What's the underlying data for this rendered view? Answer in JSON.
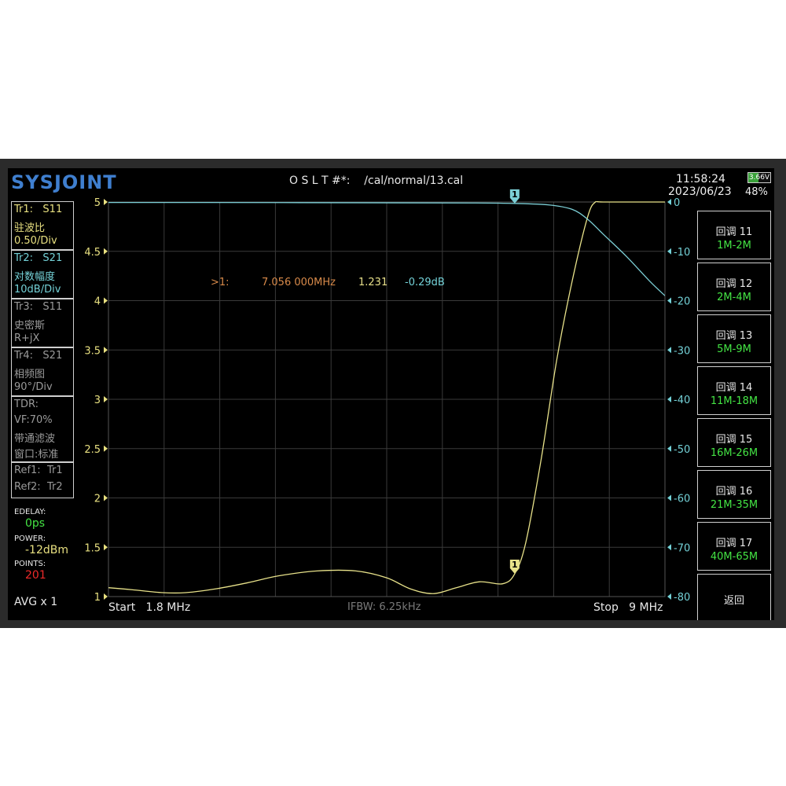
{
  "header": {
    "logo": "SYSJOINT",
    "cal_file": "O S L T #*:    /cal/normal/13.cal",
    "time": "11:58:24",
    "date": "2023/06/23",
    "battery_voltage": "3.66V",
    "battery_percent": "48%",
    "battery_fill_fraction": 0.48
  },
  "traces": [
    {
      "title": "Tr1:   S11",
      "format": "驻波比",
      "scale": "0.50/Div"
    },
    {
      "title": "Tr2:   S21",
      "format": "对数幅度",
      "scale": "10dB/Div"
    },
    {
      "title": "Tr3:   S11",
      "format": "史密斯",
      "scale": "R+jX"
    },
    {
      "title": "Tr4:   S21",
      "format": "相频图",
      "scale": "90°/Div"
    }
  ],
  "tdr": {
    "line1": "TDR:",
    "line2": "VF:70%",
    "line3": "带通滤波",
    "line4": "窗口:标准"
  },
  "refs": {
    "ref1": "Ref1:  Tr1",
    "ref2": "Ref2:  Tr2"
  },
  "params": {
    "edelay_label": "EDELAY:",
    "edelay_value": "0ps",
    "power_label": "POWER:",
    "power_value": "-12dBm",
    "points_label": "POINTS:",
    "points_value": "201",
    "avg": "AVG x 1"
  },
  "marker_readout": {
    "label": ">1:",
    "freq": "7.056 000MHz",
    "swr": "1.231",
    "db": "-0.29dB"
  },
  "sweep": {
    "start": "Start   1.8 MHz",
    "ifbw": "IFBW: 6.25kHz",
    "stop": "Stop   9 MHz"
  },
  "softkeys": [
    {
      "line1": "回调 11",
      "line2": "1M-2M"
    },
    {
      "line1": "回调 12",
      "line2": "2M-4M"
    },
    {
      "line1": "回调 13",
      "line2": "5M-9M"
    },
    {
      "line1": "回调 14",
      "line2": "11M-18M"
    },
    {
      "line1": "回调 15",
      "line2": "16M-26M"
    },
    {
      "line1": "回调 16",
      "line2": "21M-35M"
    },
    {
      "line1": "回调 17",
      "line2": "40M-65M"
    },
    {
      "line1": "返回",
      "line2": ""
    }
  ],
  "chart_data": {
    "type": "line",
    "x_range_mhz": [
      1.8,
      9
    ],
    "left_axis": {
      "ticks": [
        "5",
        "4.5",
        "4",
        "3.5",
        "3",
        "2.5",
        "2",
        "1.5",
        "1"
      ],
      "range": [
        1,
        5
      ]
    },
    "right_axis": {
      "ticks": [
        "0",
        "-10",
        "-20",
        "-30",
        "-40",
        "-50",
        "-60",
        "-70",
        "-80"
      ],
      "range": [
        -80,
        0
      ]
    },
    "grid": true,
    "marker_label": "1",
    "marker_freq_mhz": 7.056,
    "series": [
      {
        "color": "#e8e28a",
        "axis": "left",
        "x": [
          1.8,
          2.1,
          2.5,
          2.8,
          3.2,
          3.6,
          4.0,
          4.5,
          5.0,
          5.4,
          5.7,
          6.0,
          6.3,
          6.6,
          6.9,
          7.056,
          7.2,
          7.4,
          7.6,
          7.8,
          8.0,
          8.1,
          8.2,
          9.0
        ],
        "y": [
          1.09,
          1.07,
          1.04,
          1.04,
          1.08,
          1.14,
          1.21,
          1.26,
          1.26,
          1.19,
          1.08,
          1.03,
          1.09,
          1.15,
          1.13,
          1.231,
          1.55,
          2.4,
          3.4,
          4.2,
          4.85,
          5.0,
          5.0,
          5.0
        ]
      },
      {
        "color": "#7ccfd6",
        "axis": "right",
        "x": [
          1.8,
          3.0,
          5.0,
          6.5,
          7.056,
          7.5,
          7.8,
          8.0,
          8.2,
          8.5,
          8.8,
          9.0
        ],
        "y": [
          -0.1,
          -0.1,
          -0.15,
          -0.2,
          -0.29,
          -0.6,
          -1.5,
          -3.5,
          -6.5,
          -11,
          -16,
          -19
        ]
      }
    ]
  }
}
